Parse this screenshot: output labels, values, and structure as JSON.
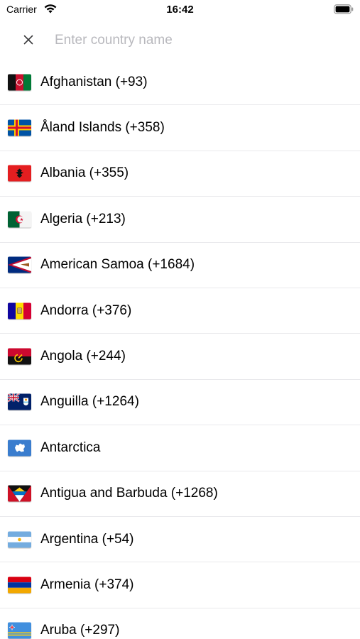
{
  "status_bar": {
    "carrier": "Carrier",
    "time": "16:42",
    "icons": [
      "wifi-icon",
      "battery-icon"
    ]
  },
  "search": {
    "placeholder": "Enter country name",
    "value": "",
    "close_icon": "close-icon"
  },
  "countries": [
    {
      "label": "Afghanistan (+93)",
      "flag": "flag-afghanistan-icon"
    },
    {
      "label": "Åland Islands (+358)",
      "flag": "flag-aland-islands-icon"
    },
    {
      "label": "Albania (+355)",
      "flag": "flag-albania-icon"
    },
    {
      "label": "Algeria (+213)",
      "flag": "flag-algeria-icon"
    },
    {
      "label": "American Samoa (+1684)",
      "flag": "flag-american-samoa-icon"
    },
    {
      "label": "Andorra (+376)",
      "flag": "flag-andorra-icon"
    },
    {
      "label": "Angola (+244)",
      "flag": "flag-angola-icon"
    },
    {
      "label": "Anguilla (+1264)",
      "flag": "flag-anguilla-icon"
    },
    {
      "label": "Antarctica",
      "flag": "flag-antarctica-icon"
    },
    {
      "label": "Antigua and Barbuda (+1268)",
      "flag": "flag-antigua-barbuda-icon"
    },
    {
      "label": "Argentina (+54)",
      "flag": "flag-argentina-icon"
    },
    {
      "label": "Armenia (+374)",
      "flag": "flag-armenia-icon"
    },
    {
      "label": "Aruba (+297)",
      "flag": "flag-aruba-icon"
    }
  ],
  "colors": {
    "placeholder": "#b8b8bd",
    "separator": "#e9e9ec",
    "text": "#000000"
  }
}
